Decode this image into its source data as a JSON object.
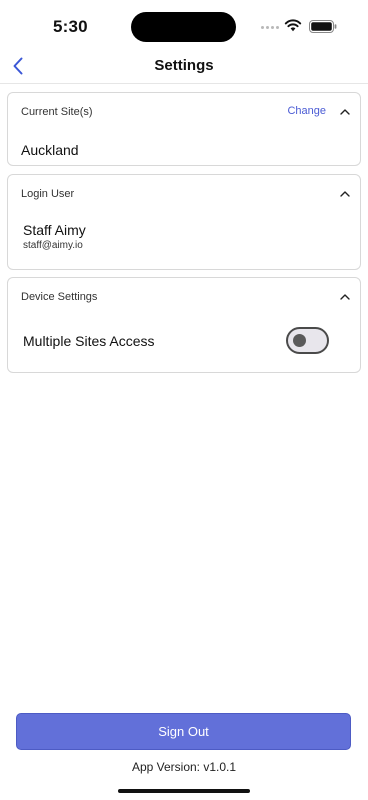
{
  "status_bar": {
    "time": "5:30",
    "icons": [
      "signal-dots-icon",
      "wifi-icon",
      "battery-icon"
    ]
  },
  "nav": {
    "title": "Settings",
    "back_icon": "chevron-left-icon"
  },
  "current_site": {
    "heading": "Current Site(s)",
    "change_label": "Change",
    "value": "Auckland",
    "expanded": true
  },
  "login_user": {
    "heading": "Login User",
    "name": "Staff Aimy",
    "email": "staff@aimy.io",
    "expanded": true
  },
  "device_settings": {
    "heading": "Device Settings",
    "multiple_sites_label": "Multiple Sites Access",
    "multiple_sites_enabled": false,
    "expanded": true
  },
  "footer": {
    "sign_out_label": "Sign Out",
    "app_version": "App Version: v1.0.1"
  },
  "colors": {
    "accent": "#6270d9",
    "link": "#4a5bd4",
    "border": "#d8d8d8"
  }
}
